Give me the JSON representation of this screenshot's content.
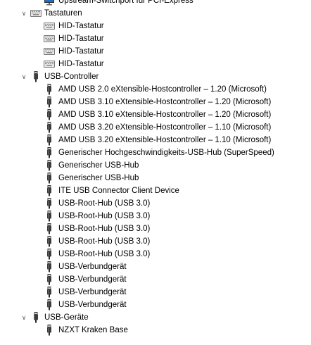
{
  "partial_top_item": {
    "label": "Upstream-Switchport für PCI-Express",
    "icon": "monitor-icon"
  },
  "categories": [
    {
      "id": "tastaturen",
      "label": "Tastaturen",
      "expanded": true,
      "expander_glyph": "∨",
      "icon": "keyboard-icon",
      "devices": [
        {
          "label": "HID-Tastatur",
          "icon": "keyboard-icon"
        },
        {
          "label": "HID-Tastatur",
          "icon": "keyboard-icon"
        },
        {
          "label": "HID-Tastatur",
          "icon": "keyboard-icon"
        },
        {
          "label": "HID-Tastatur",
          "icon": "keyboard-icon"
        }
      ]
    },
    {
      "id": "usb-controller",
      "label": "USB-Controller",
      "expanded": true,
      "expander_glyph": "∨",
      "icon": "usb-plug-icon",
      "devices": [
        {
          "label": "AMD USB 2.0 eXtensible-Hostcontroller – 1.20 (Microsoft)",
          "icon": "usb-plug-icon"
        },
        {
          "label": "AMD USB 3.10 eXtensible-Hostcontroller – 1.20 (Microsoft)",
          "icon": "usb-plug-icon"
        },
        {
          "label": "AMD USB 3.10 eXtensible-Hostcontroller – 1.20 (Microsoft)",
          "icon": "usb-plug-icon"
        },
        {
          "label": "AMD USB 3.20 eXtensible-Hostcontroller – 1.10 (Microsoft)",
          "icon": "usb-plug-icon"
        },
        {
          "label": "AMD USB 3.20 eXtensible-Hostcontroller – 1.10 (Microsoft)",
          "icon": "usb-plug-icon"
        },
        {
          "label": "Generischer Hochgeschwindigkeits-USB-Hub (SuperSpeed)",
          "icon": "usb-plug-icon"
        },
        {
          "label": "Generischer USB-Hub",
          "icon": "usb-plug-icon"
        },
        {
          "label": "Generischer USB-Hub",
          "icon": "usb-plug-icon"
        },
        {
          "label": "ITE USB Connector Client Device",
          "icon": "usb-plug-icon"
        },
        {
          "label": "USB-Root-Hub (USB 3.0)",
          "icon": "usb-plug-icon"
        },
        {
          "label": "USB-Root-Hub (USB 3.0)",
          "icon": "usb-plug-icon"
        },
        {
          "label": "USB-Root-Hub (USB 3.0)",
          "icon": "usb-plug-icon"
        },
        {
          "label": "USB-Root-Hub (USB 3.0)",
          "icon": "usb-plug-icon"
        },
        {
          "label": "USB-Root-Hub (USB 3.0)",
          "icon": "usb-plug-icon"
        },
        {
          "label": "USB-Verbundgerät",
          "icon": "usb-plug-icon"
        },
        {
          "label": "USB-Verbundgerät",
          "icon": "usb-plug-icon"
        },
        {
          "label": "USB-Verbundgerät",
          "icon": "usb-plug-icon"
        },
        {
          "label": "USB-Verbundgerät",
          "icon": "usb-plug-icon"
        }
      ]
    },
    {
      "id": "usb-geraete",
      "label": "USB-Geräte",
      "expanded": true,
      "expander_glyph": "∨",
      "icon": "usb-plug-icon",
      "devices": [
        {
          "label": "NZXT Kraken Base",
          "icon": "usb-plug-icon"
        }
      ]
    }
  ],
  "colors": {
    "text": "#000000",
    "expander": "#5a5a5a",
    "keyboard_body": "#e6e6e6",
    "keyboard_border": "#7a7a7a",
    "usb_dark": "#3c3c3c",
    "monitor_screen": "#1e6fc6"
  }
}
